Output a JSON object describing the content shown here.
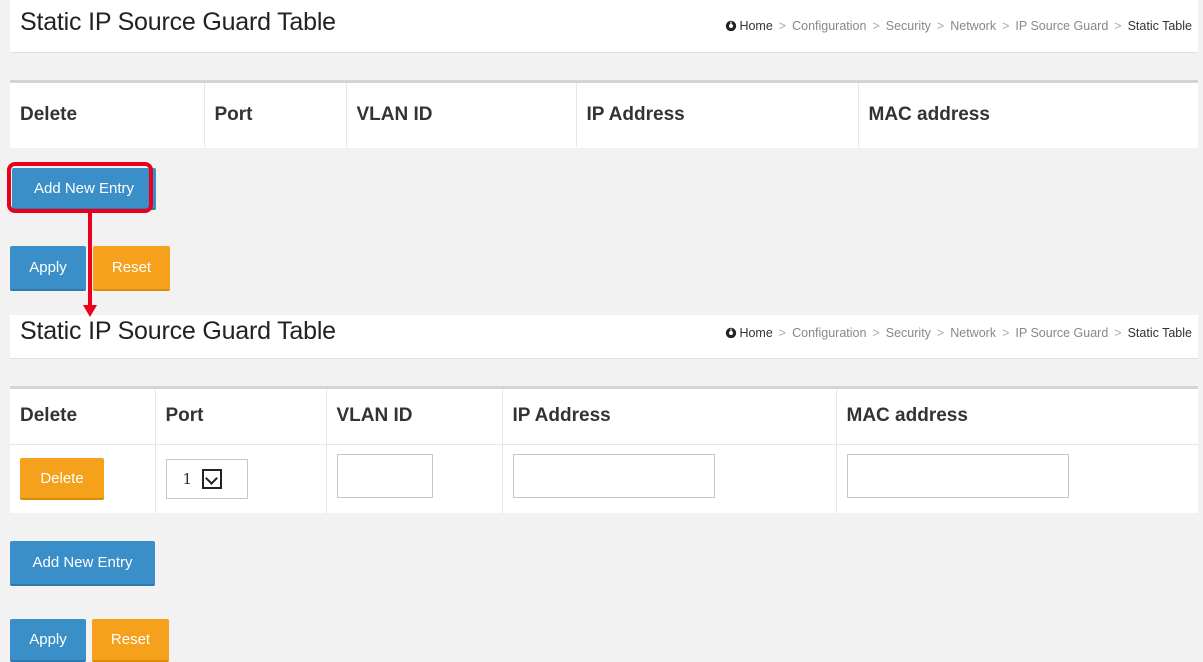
{
  "panel_top": {
    "title": "Static IP Source Guard Table",
    "breadcrumb": {
      "home": "Home",
      "items": [
        "Configuration",
        "Security",
        "Network",
        "IP Source Guard"
      ],
      "current": "Static Table",
      "separator": ">"
    },
    "columns": [
      "Delete",
      "Port",
      "VLAN ID",
      "IP Address",
      "MAC address"
    ],
    "add_button": "Add New Entry",
    "apply_button": "Apply",
    "reset_button": "Reset"
  },
  "panel_bottom": {
    "title": "Static IP Source Guard Table",
    "breadcrumb": {
      "home": "Home",
      "items": [
        "Configuration",
        "Security",
        "Network",
        "IP Source Guard"
      ],
      "current": "Static Table",
      "separator": ">"
    },
    "columns": [
      "Delete",
      "Port",
      "VLAN ID",
      "IP Address",
      "MAC address"
    ],
    "row": {
      "delete_button": "Delete",
      "port_value": "1",
      "vlan_id": "",
      "ip_address": "",
      "mac_address": ""
    },
    "add_button": "Add New Entry",
    "apply_button": "Apply",
    "reset_button": "Reset"
  },
  "colors": {
    "primary_button": "#3a8fc9",
    "warning_button": "#f5a11b",
    "highlight": "#e8001c"
  },
  "icons": {
    "home": "dashboard-gauge-icon",
    "dropdown": "chevron-down-icon"
  }
}
